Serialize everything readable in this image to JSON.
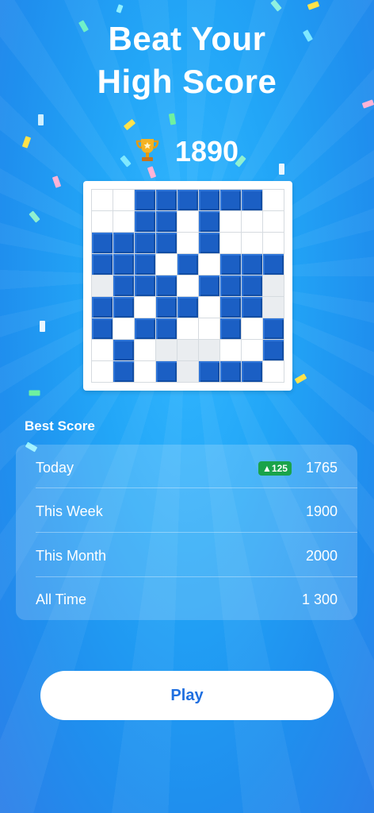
{
  "header": {
    "title_line1": "Beat Your",
    "title_line2": "High Score"
  },
  "score": {
    "value": "1890",
    "icon": "trophy-icon"
  },
  "board": {
    "rows": [
      "..bbbbbb.",
      "..bb.b...",
      "bbbb.b...",
      "bbb.b.bbb",
      "gbbb.bbbg",
      "bb.bb.bbg",
      "b.bb..b.b",
      ".b.ggg..b",
      ".b.bgbbb."
    ]
  },
  "best_score": {
    "label": "Best Score",
    "rows": [
      {
        "label": "Today",
        "badge": "▲125",
        "value": "1765"
      },
      {
        "label": "This Week",
        "value": "1900"
      },
      {
        "label": "This Month",
        "value": "2000"
      },
      {
        "label": "All Time",
        "value": "1 300"
      }
    ]
  },
  "play_button": {
    "label": "Play"
  },
  "colors": {
    "accent": "#1f6fe0",
    "block": "#1b5fc4",
    "badge": "#1aa34a"
  }
}
